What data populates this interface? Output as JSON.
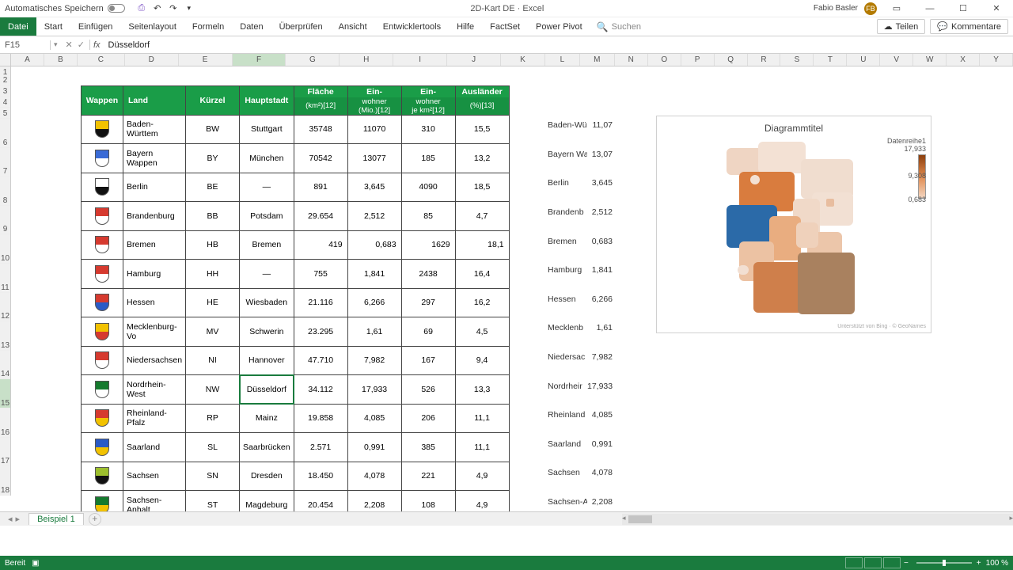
{
  "titlebar": {
    "autosave": "Automatisches Speichern",
    "doc": "2D-Kart DE",
    "app": "Excel",
    "user": "Fabio Basler",
    "initials": "FB"
  },
  "ribbon": {
    "tabs": [
      "Datei",
      "Start",
      "Einfügen",
      "Seitenlayout",
      "Formeln",
      "Daten",
      "Überprüfen",
      "Ansicht",
      "Entwicklertools",
      "Hilfe",
      "FactSet",
      "Power Pivot"
    ],
    "search_ph": "Suchen",
    "share": "Teilen",
    "comments": "Kommentare"
  },
  "formula": {
    "ref": "F15",
    "value": "Düsseldorf"
  },
  "columns": [
    "A",
    "B",
    "C",
    "D",
    "E",
    "F",
    "G",
    "H",
    "I",
    "J",
    "K",
    "L",
    "M",
    "N",
    "O",
    "P",
    "Q",
    "R",
    "S",
    "T",
    "U",
    "V",
    "W",
    "X",
    "Y"
  ],
  "table": {
    "headers": {
      "wappen": "Wappen",
      "land": "Land",
      "kuerzel": "Kürzel",
      "haupt": "Hauptstadt",
      "flaeche1": "Fläche",
      "flaeche2": "(km²)[12]",
      "ew1": "Ein-",
      "ew2": "wohner",
      "ew3": "(Mio.)[12]",
      "ewk1": "Ein-",
      "ewk2": "wohner",
      "ewk3": "je km²[12]",
      "aus1": "Ausländer",
      "aus2": "(%)[13]"
    },
    "rows": [
      {
        "land": "Baden-Württem",
        "k": "BW",
        "h": "Stuttgart",
        "f": "35748",
        "e": "11070",
        "d": "310",
        "a": "15,5",
        "c1": "#f2c200",
        "c2": "#111"
      },
      {
        "land": "Bayern Wappen",
        "k": "BY",
        "h": "München",
        "f": "70542",
        "e": "13077",
        "d": "185",
        "a": "13,2",
        "c1": "#3a6bd6",
        "c2": "#fff"
      },
      {
        "land": "Berlin",
        "k": "BE",
        "h": "—",
        "f": "891",
        "e": "3,645",
        "d": "4090",
        "a": "18,5",
        "c1": "#fff",
        "c2": "#111"
      },
      {
        "land": "Brandenburg",
        "k": "BB",
        "h": "Potsdam",
        "f": "29.654",
        "e": "2,512",
        "d": "85",
        "a": "4,7",
        "c1": "#d63a2f",
        "c2": "#fff"
      },
      {
        "land": "Bremen",
        "k": "HB",
        "h": "Bremen",
        "f": "419",
        "e": "0,683",
        "d": "1629",
        "a": "18,1",
        "c1": "#d63a2f",
        "c2": "#fff",
        "ralign": true
      },
      {
        "land": "Hamburg",
        "k": "HH",
        "h": "—",
        "f": "755",
        "e": "1,841",
        "d": "2438",
        "a": "16,4",
        "c1": "#d63a2f",
        "c2": "#fff"
      },
      {
        "land": "Hessen",
        "k": "HE",
        "h": "Wiesbaden",
        "f": "21.116",
        "e": "6,266",
        "d": "297",
        "a": "16,2",
        "c1": "#d63a2f",
        "c2": "#2a5bc6"
      },
      {
        "land": "Mecklenburg-Vo",
        "k": "MV",
        "h": "Schwerin",
        "f": "23.295",
        "e": "1,61",
        "d": "69",
        "a": "4,5",
        "c1": "#f2c200",
        "c2": "#d63a2f"
      },
      {
        "land": "Niedersachsen",
        "k": "NI",
        "h": "Hannover",
        "f": "47.710",
        "e": "7,982",
        "d": "167",
        "a": "9,4",
        "c1": "#d63a2f",
        "c2": "#fff"
      },
      {
        "land": "Nordrhein-West",
        "k": "NW",
        "h": "Düsseldorf",
        "f": "34.112",
        "e": "17,933",
        "d": "526",
        "a": "13,3",
        "c1": "#157a2e",
        "c2": "#fff",
        "sel": true
      },
      {
        "land": "Rheinland-Pfalz",
        "k": "RP",
        "h": "Mainz",
        "f": "19.858",
        "e": "4,085",
        "d": "206",
        "a": "11,1",
        "c1": "#d63a2f",
        "c2": "#f2c200"
      },
      {
        "land": "Saarland",
        "k": "SL",
        "h": "Saarbrücken",
        "f": "2.571",
        "e": "0,991",
        "d": "385",
        "a": "11,1",
        "c1": "#2a5bc6",
        "c2": "#f2c200"
      },
      {
        "land": "Sachsen",
        "k": "SN",
        "h": "Dresden",
        "f": "18.450",
        "e": "4,078",
        "d": "221",
        "a": "4,9",
        "c1": "#9dbf2e",
        "c2": "#111"
      },
      {
        "land": "Sachsen-Anhalt",
        "k": "ST",
        "h": "Magdeburg",
        "f": "20.454",
        "e": "2,208",
        "d": "108",
        "a": "4,9",
        "c1": "#157a2e",
        "c2": "#f2c200"
      }
    ]
  },
  "minilist": [
    {
      "l": "Baden-Wü",
      "v": "11,07"
    },
    {
      "l": "Bayern Wa",
      "v": "13,07"
    },
    {
      "l": "Berlin",
      "v": "3,645"
    },
    {
      "l": "Brandenb",
      "v": "2,512"
    },
    {
      "l": "Bremen",
      "v": "0,683"
    },
    {
      "l": "Hamburg",
      "v": "1,841"
    },
    {
      "l": "Hessen",
      "v": "6,266"
    },
    {
      "l": "Mecklenb",
      "v": "1,61"
    },
    {
      "l": "Niedersac",
      "v": "7,982"
    },
    {
      "l": "Nordrheir",
      "v": "17,933"
    },
    {
      "l": "Rheinland",
      "v": "4,085"
    },
    {
      "l": "Saarland",
      "v": "0,991"
    },
    {
      "l": "Sachsen",
      "v": "4,078"
    },
    {
      "l": "Sachsen-A",
      "v": "2,208"
    }
  ],
  "chart_data": {
    "type": "heatmap",
    "title": "Diagrammtitel",
    "series_name": "Datenreihe1",
    "scale": {
      "max": "17,933",
      "mid": "9,308",
      "min": "0,683"
    },
    "credits": "Unterstützt von Bing · © GeoNames"
  },
  "sheet": {
    "name": "Beispiel 1"
  },
  "status": {
    "ready": "Bereit",
    "zoom": "100 %"
  }
}
